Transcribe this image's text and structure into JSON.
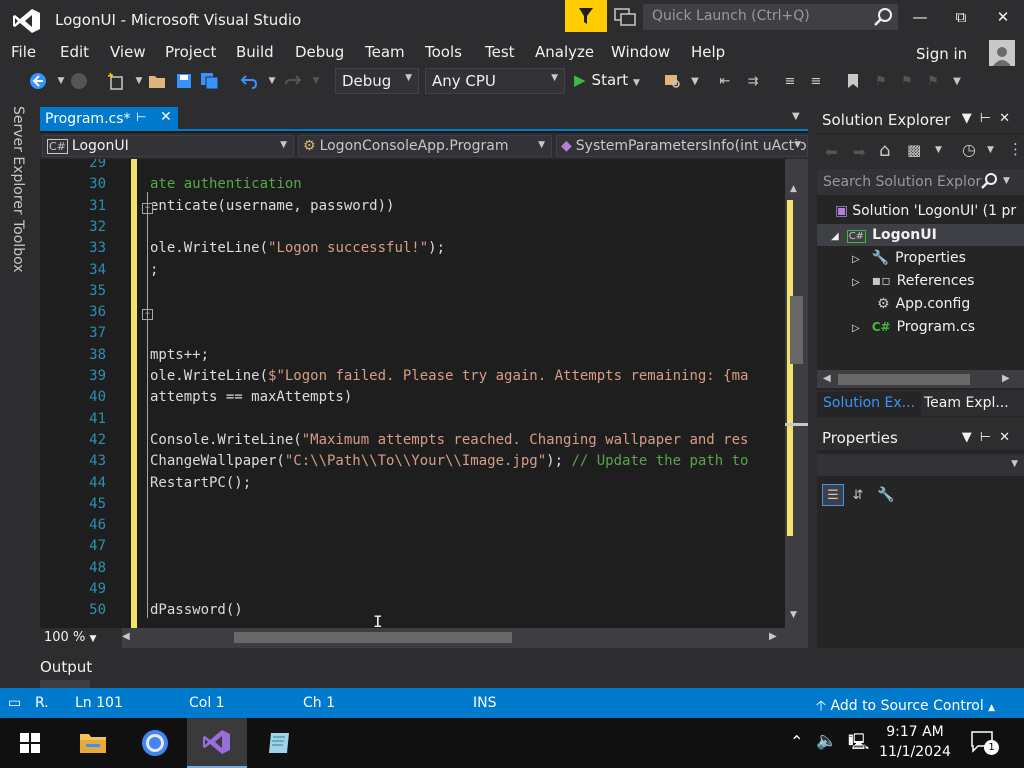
{
  "window": {
    "title": "LogonUI - Microsoft Visual Studio",
    "quick_launch_placeholder": "Quick Launch (Ctrl+Q)",
    "sign_in": "Sign in"
  },
  "menu": [
    "File",
    "Edit",
    "View",
    "Project",
    "Build",
    "Debug",
    "Team",
    "Tools",
    "Test",
    "Analyze",
    "Window",
    "Help"
  ],
  "toolbar": {
    "config": "Debug",
    "platform": "Any CPU",
    "start": "Start"
  },
  "side_tabs": {
    "server_explorer": "Server Explorer",
    "toolbox": "Toolbox"
  },
  "editor": {
    "tab": "Program.cs*",
    "nav_project": "LogonUI",
    "nav_class": "LogonConsoleApp.Program",
    "nav_member": "SystemParametersInfo(int uActio",
    "zoom": "100 %",
    "lines": [
      {
        "n": "29",
        "text": ""
      },
      {
        "n": "30",
        "text": "ate authentication",
        "kind": "comment"
      },
      {
        "n": "31",
        "text": "enticate(username, password))"
      },
      {
        "n": "32",
        "text": ""
      },
      {
        "n": "33",
        "text": "ole.WriteLine(\"Logon successful!\");"
      },
      {
        "n": "34",
        "text": ";"
      },
      {
        "n": "35",
        "text": ""
      },
      {
        "n": "36",
        "text": ""
      },
      {
        "n": "37",
        "text": ""
      },
      {
        "n": "38",
        "text": "mpts++;"
      },
      {
        "n": "39",
        "text": "ole.WriteLine($\"Logon failed. Please try again. Attempts remaining: {ma"
      },
      {
        "n": "40",
        "text": "attempts == maxAttempts)"
      },
      {
        "n": "41",
        "text": ""
      },
      {
        "n": "42",
        "text": "Console.WriteLine(\"Maximum attempts reached. Changing wallpaper and res"
      },
      {
        "n": "43",
        "text": "ChangeWallpaper(\"C:\\\\Path\\\\To\\\\Your\\\\Image.jpg\"); // Update the path to"
      },
      {
        "n": "44",
        "text": "RestartPC();"
      },
      {
        "n": "45",
        "text": ""
      },
      {
        "n": "46",
        "text": ""
      },
      {
        "n": "47",
        "text": ""
      },
      {
        "n": "48",
        "text": ""
      },
      {
        "n": "49",
        "text": ""
      },
      {
        "n": "50",
        "text": "dPassword()"
      }
    ]
  },
  "output_label": "Output",
  "solution_explorer": {
    "title": "Solution Explorer",
    "search_placeholder": "Search Solution Explor",
    "solution": "Solution 'LogonUI' (1 pr",
    "project": "LogonUI",
    "items": [
      "Properties",
      "References",
      "App.config",
      "Program.cs"
    ],
    "tabs": [
      "Solution Ex...",
      "Team Expl..."
    ]
  },
  "properties": {
    "title": "Properties"
  },
  "status": {
    "ready": "R.",
    "ln": "Ln 101",
    "col": "Col 1",
    "ch": "Ch 1",
    "ins": "INS",
    "source_control": "Add to Source Control"
  },
  "taskbar": {
    "time": "9:17 AM",
    "date": "11/1/2024",
    "notifications": "1"
  },
  "colors": {
    "accent": "#007acc",
    "comment": "#57a64a",
    "string": "#d69d85",
    "linenum": "#2b91af",
    "change_margin": "#f2e36c"
  }
}
